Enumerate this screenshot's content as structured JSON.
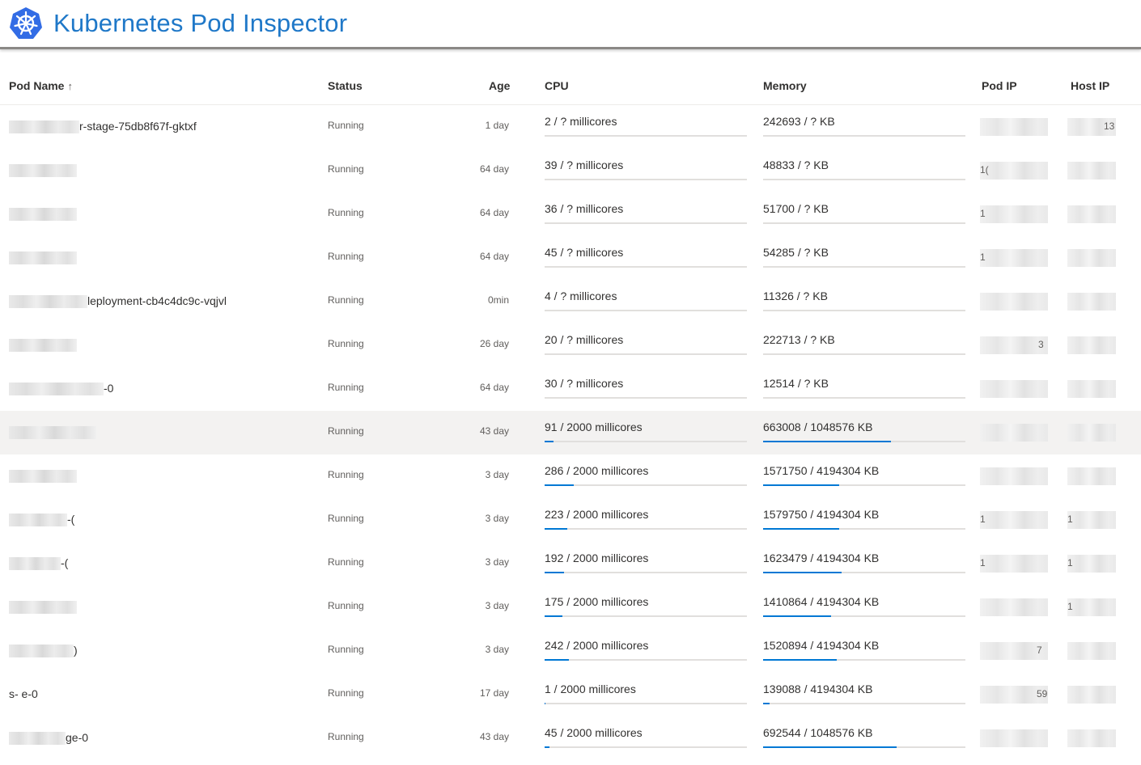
{
  "app": {
    "title": "Kubernetes Pod Inspector",
    "logo_icon": "kubernetes-helm-icon",
    "accent_color": "#1f78c8",
    "bar_color": "#0078d4"
  },
  "columns": {
    "name": "Pod Name",
    "sort_indicator": "↑",
    "status": "Status",
    "age": "Age",
    "cpu": "CPU",
    "memory": "Memory",
    "pod_ip": "Pod IP",
    "host_ip": "Host IP"
  },
  "pods": [
    {
      "name_visible": "r-stage-75db8f67f-gktxf",
      "status": "Running",
      "age": "1 day",
      "cpu": "2 / ? millicores",
      "cpu_pct": 0,
      "memory": "242693 / ? KB",
      "mem_pct": 0,
      "pod_ip_visible": "",
      "host_ip_visible": "13",
      "selected": false
    },
    {
      "name_visible": "",
      "status": "Running",
      "age": "64 day",
      "cpu": "39 / ? millicores",
      "cpu_pct": 0,
      "memory": "48833 / ? KB",
      "mem_pct": 0,
      "pod_ip_visible": "1(",
      "host_ip_visible": "",
      "selected": false
    },
    {
      "name_visible": "",
      "status": "Running",
      "age": "64 day",
      "cpu": "36 / ? millicores",
      "cpu_pct": 0,
      "memory": "51700 / ? KB",
      "mem_pct": 0,
      "pod_ip_visible": "1",
      "host_ip_visible": "",
      "selected": false
    },
    {
      "name_visible": "",
      "status": "Running",
      "age": "64 day",
      "cpu": "45 / ? millicores",
      "cpu_pct": 0,
      "memory": "54285 / ? KB",
      "mem_pct": 0,
      "pod_ip_visible": "1",
      "host_ip_visible": "",
      "selected": false
    },
    {
      "name_visible": "leployment-cb4c4dc9c-vqjvl",
      "status": "Running",
      "age": "0min",
      "cpu": "4 / ? millicores",
      "cpu_pct": 0,
      "memory": "11326 / ? KB",
      "mem_pct": 0,
      "pod_ip_visible": "",
      "host_ip_visible": "",
      "selected": false
    },
    {
      "name_visible": "",
      "status": "Running",
      "age": "26 day",
      "cpu": "20 / ? millicores",
      "cpu_pct": 0,
      "memory": "222713 / ? KB",
      "mem_pct": 0,
      "pod_ip_visible": "3",
      "host_ip_visible": "",
      "selected": false
    },
    {
      "name_visible": "-0",
      "status": "Running",
      "age": "64 day",
      "cpu": "30 / ? millicores",
      "cpu_pct": 0,
      "memory": "12514 / ? KB",
      "mem_pct": 0,
      "pod_ip_visible": "",
      "host_ip_visible": "",
      "selected": false
    },
    {
      "name_visible": "",
      "status": "Running",
      "age": "43 day",
      "cpu": "91 / 2000 millicores",
      "cpu_pct": 4.55,
      "memory": "663008 / 1048576 KB",
      "mem_pct": 63.2,
      "pod_ip_visible": "",
      "host_ip_visible": "",
      "selected": true
    },
    {
      "name_visible": "",
      "status": "Running",
      "age": "3 day",
      "cpu": "286 / 2000 millicores",
      "cpu_pct": 14.3,
      "memory": "1571750 / 4194304 KB",
      "mem_pct": 37.5,
      "pod_ip_visible": "",
      "host_ip_visible": "",
      "selected": false
    },
    {
      "name_visible": "-(",
      "status": "Running",
      "age": "3 day",
      "cpu": "223 / 2000 millicores",
      "cpu_pct": 11.15,
      "memory": "1579750 / 4194304 KB",
      "mem_pct": 37.7,
      "pod_ip_visible": "1",
      "host_ip_visible": "1",
      "selected": false
    },
    {
      "name_visible": "-(",
      "status": "Running",
      "age": "3 day",
      "cpu": "192 / 2000 millicores",
      "cpu_pct": 9.6,
      "memory": "1623479 / 4194304 KB",
      "mem_pct": 38.7,
      "pod_ip_visible": "1",
      "host_ip_visible": "1",
      "selected": false
    },
    {
      "name_visible": "",
      "status": "Running",
      "age": "3 day",
      "cpu": "175 / 2000 millicores",
      "cpu_pct": 8.75,
      "memory": "1410864 / 4194304 KB",
      "mem_pct": 33.6,
      "pod_ip_visible": "",
      "host_ip_visible": "1",
      "selected": false
    },
    {
      "name_visible": ")",
      "status": "Running",
      "age": "3 day",
      "cpu": "242 / 2000 millicores",
      "cpu_pct": 12.1,
      "memory": "1520894 / 4194304 KB",
      "mem_pct": 36.3,
      "pod_ip_visible": "7",
      "host_ip_visible": "",
      "selected": false
    },
    {
      "name_visible": "s-           e-0",
      "status": "Running",
      "age": "17 day",
      "cpu": "1 / 2000 millicores",
      "cpu_pct": 0.05,
      "memory": "139088 / 4194304 KB",
      "mem_pct": 3.3,
      "pod_ip_visible": "59",
      "host_ip_visible": "",
      "selected": false
    },
    {
      "name_visible": "ge-0",
      "status": "Running",
      "age": "43 day",
      "cpu": "45 / 2000 millicores",
      "cpu_pct": 2.25,
      "memory": "692544 / 1048576 KB",
      "mem_pct": 66.0,
      "pod_ip_visible": "",
      "host_ip_visible": "",
      "selected": false
    }
  ]
}
